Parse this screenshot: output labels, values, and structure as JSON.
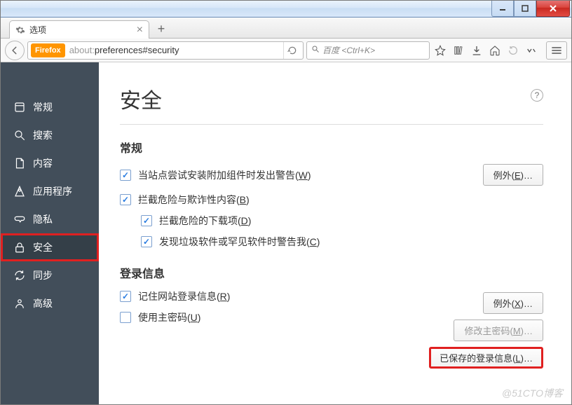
{
  "window": {
    "close": "",
    "max": "",
    "min": ""
  },
  "tab": {
    "title": "选项",
    "new_tab": "+"
  },
  "url": {
    "badge": "Firefox",
    "scheme": "about:",
    "path": "preferences#security"
  },
  "search": {
    "placeholder": "百度 <Ctrl+K>"
  },
  "sidebar": {
    "items": [
      {
        "label": "常规"
      },
      {
        "label": "搜索"
      },
      {
        "label": "内容"
      },
      {
        "label": "应用程序"
      },
      {
        "label": "隐私"
      },
      {
        "label": "安全"
      },
      {
        "label": "同步"
      },
      {
        "label": "高级"
      }
    ]
  },
  "page": {
    "title": "安全",
    "help": "?"
  },
  "section_general": {
    "heading": "常规",
    "opt_addon_warn": "当站点尝试安装附加组件时发出警告(W)",
    "opt_block_deceptive": "拦截危险与欺诈性内容(B)",
    "opt_block_downloads": "拦截危险的下载项(D)",
    "opt_warn_unwanted": "发现垃圾软件或罕见软件时警告我(C)",
    "btn_exceptions": "例外(E)…"
  },
  "section_login": {
    "heading": "登录信息",
    "opt_remember": "记住网站登录信息(R)",
    "opt_master": "使用主密码(U)",
    "btn_exceptions": "例外(X)…",
    "btn_change_master": "修改主密码(M)…",
    "btn_saved": "已保存的登录信息(L)…"
  },
  "watermark": "@51CTO博客"
}
